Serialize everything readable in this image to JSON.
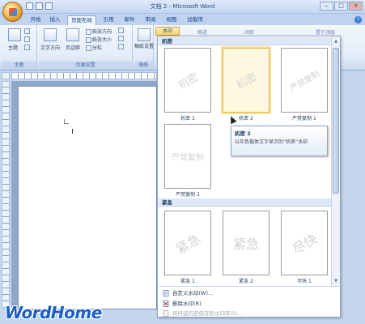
{
  "window": {
    "title": "文档 2 - Microsoft Word",
    "controls": [
      "–",
      "□",
      "×"
    ]
  },
  "tabs": [
    {
      "label": "开始",
      "active": false
    },
    {
      "label": "插入",
      "active": false
    },
    {
      "label": "页面布局",
      "active": true
    },
    {
      "label": "引用",
      "active": false
    },
    {
      "label": "邮件",
      "active": false
    },
    {
      "label": "审阅",
      "active": false
    },
    {
      "label": "视图",
      "active": false
    },
    {
      "label": "加载项",
      "active": false
    }
  ],
  "ribbon": {
    "theme_group": {
      "label": "主题",
      "button": "主题"
    },
    "page_setup_group": {
      "label": "页面设置",
      "text_direction": "文字方向",
      "margins": "页边距",
      "orientation": "纸张方向",
      "size": "纸张大小",
      "columns": "分栏"
    },
    "paper_group": {
      "label": "稿纸",
      "button": "稿纸设置"
    },
    "watermark_button": "水印",
    "hidden_labels": [
      "缩进",
      "间距"
    ],
    "bring_front": "置于顶层"
  },
  "gallery": {
    "sections": [
      {
        "heading": "机密",
        "items": [
          {
            "label": "机密 1",
            "watermark": "机密",
            "style": "diagonal"
          },
          {
            "label": "机密 2",
            "watermark": "机密",
            "style": "diagonal",
            "hover": true
          },
          {
            "label": "严禁复制 1",
            "watermark": "严禁复制",
            "style": "diagonal"
          },
          {
            "label": "严禁复制 2",
            "watermark": "严禁复制",
            "style": "flat"
          }
        ]
      },
      {
        "heading": "紧急",
        "items": [
          {
            "label": "紧急 1",
            "watermark": "紧急",
            "style": "diagonal"
          },
          {
            "label": "紧急 2",
            "watermark": "紧急",
            "style": "flat"
          },
          {
            "label": "尽快 1",
            "watermark": "尽快",
            "style": "diagonal"
          }
        ]
      }
    ],
    "menu": [
      {
        "label": "自定义水印(W)...",
        "disabled": false
      },
      {
        "label": "删除水印(R)",
        "disabled": false
      },
      {
        "label": "将所选内容保存到水印库(S)...",
        "disabled": true
      }
    ]
  },
  "tooltip": {
    "title": "机密 2",
    "body": "以灰色楷体文字显示的“机密”水印"
  },
  "logo": "WordHome"
}
